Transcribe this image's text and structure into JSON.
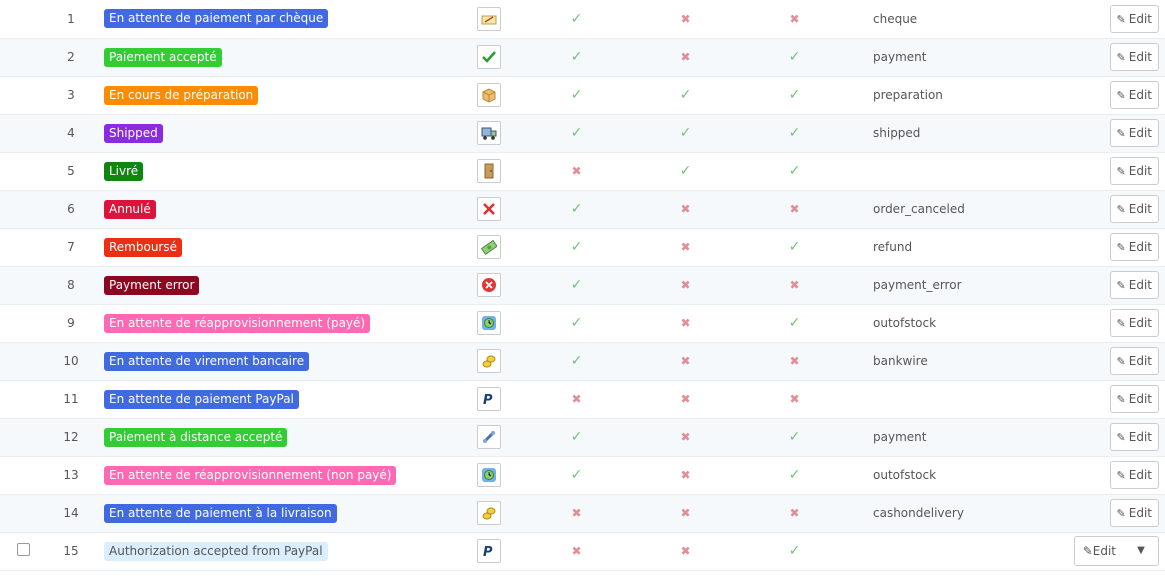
{
  "edit_label": "Edit",
  "rows": [
    {
      "id": "1",
      "name": "En attente de paiement par chèque",
      "color": "#4169e1",
      "text_color": "#fff",
      "icon": "cheque-icon",
      "invoice": true,
      "send_email": false,
      "delivery": false,
      "template": "cheque"
    },
    {
      "id": "2",
      "name": "Paiement accepté",
      "color": "#32cd32",
      "text_color": "#fff",
      "icon": "checkmark-icon",
      "invoice": true,
      "send_email": false,
      "delivery": true,
      "template": "payment"
    },
    {
      "id": "3",
      "name": "En cours de préparation",
      "color": "#ff8c00",
      "text_color": "#fff",
      "icon": "package-icon",
      "invoice": true,
      "send_email": true,
      "delivery": true,
      "template": "preparation"
    },
    {
      "id": "4",
      "name": "Shipped",
      "color": "#8a2be2",
      "text_color": "#fff",
      "icon": "truck-icon",
      "invoice": true,
      "send_email": true,
      "delivery": true,
      "template": "shipped"
    },
    {
      "id": "5",
      "name": "Livré",
      "color": "#108510",
      "text_color": "#fff",
      "icon": "door-icon",
      "invoice": false,
      "send_email": true,
      "delivery": true,
      "template": ""
    },
    {
      "id": "6",
      "name": "Annulé",
      "color": "#dc143c",
      "text_color": "#fff",
      "icon": "cancel-icon",
      "invoice": true,
      "send_email": false,
      "delivery": false,
      "template": "order_canceled"
    },
    {
      "id": "7",
      "name": "Remboursé",
      "color": "#ec2e15",
      "text_color": "#fff",
      "icon": "banknote-icon",
      "invoice": true,
      "send_email": false,
      "delivery": true,
      "template": "refund"
    },
    {
      "id": "8",
      "name": "Payment error",
      "color": "#8f0621",
      "text_color": "#fff",
      "icon": "error-icon",
      "invoice": true,
      "send_email": false,
      "delivery": false,
      "template": "payment_error"
    },
    {
      "id": "9",
      "name": "En attente de réapprovisionnement (payé)",
      "color": "#ff69b4",
      "text_color": "#fff",
      "icon": "restock-icon",
      "invoice": true,
      "send_email": false,
      "delivery": true,
      "template": "outofstock"
    },
    {
      "id": "10",
      "name": "En attente de virement bancaire",
      "color": "#4169e1",
      "text_color": "#fff",
      "icon": "coins-icon",
      "invoice": true,
      "send_email": false,
      "delivery": false,
      "template": "bankwire"
    },
    {
      "id": "11",
      "name": "En attente de paiement PayPal",
      "color": "#4169e1",
      "text_color": "#fff",
      "icon": "paypal-icon",
      "invoice": false,
      "send_email": false,
      "delivery": false,
      "template": ""
    },
    {
      "id": "12",
      "name": "Paiement à distance accepté",
      "color": "#32cd32",
      "text_color": "#fff",
      "icon": "remote-payment-icon",
      "invoice": true,
      "send_email": false,
      "delivery": true,
      "template": "payment"
    },
    {
      "id": "13",
      "name": "En attente de réapprovisionnement (non payé)",
      "color": "#ff69b4",
      "text_color": "#fff",
      "icon": "restock-icon",
      "invoice": true,
      "send_email": false,
      "delivery": true,
      "template": "outofstock"
    },
    {
      "id": "14",
      "name": "En attente de paiement à la livraison",
      "color": "#4169e1",
      "text_color": "#fff",
      "icon": "coins-icon",
      "invoice": false,
      "send_email": false,
      "delivery": false,
      "template": "cashondelivery"
    },
    {
      "id": "15",
      "name": "Authorization accepted from PayPal",
      "color": "#dbeeff",
      "text_color": "#555",
      "icon": "paypal-icon",
      "invoice": false,
      "send_email": false,
      "delivery": true,
      "template": ""
    }
  ]
}
